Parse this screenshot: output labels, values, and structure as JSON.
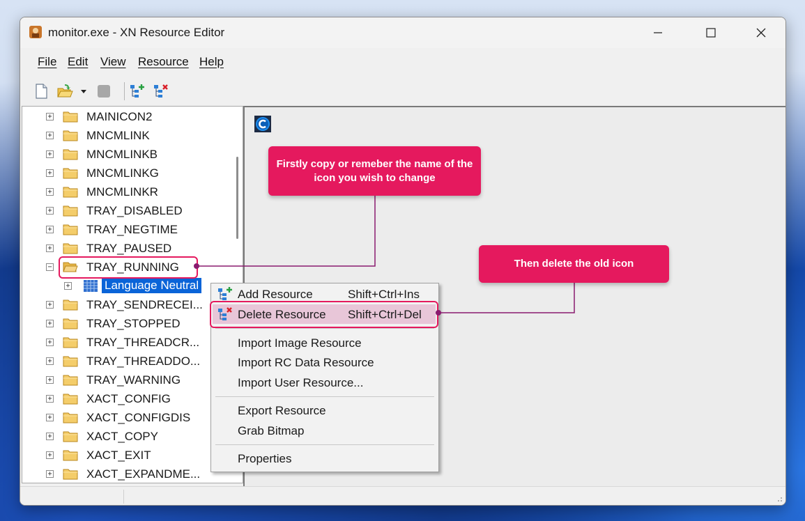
{
  "window": {
    "title": "monitor.exe - XN Resource Editor"
  },
  "menu": [
    "File",
    "Edit",
    "View",
    "Resource",
    "Help"
  ],
  "tree": {
    "items": [
      {
        "label": "MAINICON2",
        "expander": "+"
      },
      {
        "label": "MNCMLINK",
        "expander": "+"
      },
      {
        "label": "MNCMLINKB",
        "expander": "+"
      },
      {
        "label": "MNCMLINKG",
        "expander": "+"
      },
      {
        "label": "MNCMLINKR",
        "expander": "+"
      },
      {
        "label": "TRAY_DISABLED",
        "expander": "+"
      },
      {
        "label": "TRAY_NEGTIME",
        "expander": "+"
      },
      {
        "label": "TRAY_PAUSED",
        "expander": "+"
      },
      {
        "label": "TRAY_RUNNING",
        "expander": "−"
      },
      {
        "label": "Language Neutral",
        "expander": "+"
      },
      {
        "label": "TRAY_SENDRECEI...",
        "expander": "+"
      },
      {
        "label": "TRAY_STOPPED",
        "expander": "+"
      },
      {
        "label": "TRAY_THREADCR...",
        "expander": "+"
      },
      {
        "label": "TRAY_THREADDO...",
        "expander": "+"
      },
      {
        "label": "TRAY_WARNING",
        "expander": "+"
      },
      {
        "label": "XACT_CONFIG",
        "expander": "+"
      },
      {
        "label": "XACT_CONFIGDIS",
        "expander": "+"
      },
      {
        "label": "XACT_COPY",
        "expander": "+"
      },
      {
        "label": "XACT_EXIT",
        "expander": "+"
      },
      {
        "label": "XACT_EXPANDME...",
        "expander": "+"
      }
    ]
  },
  "context_menu": {
    "add": {
      "label": "Add Resource",
      "shortcut": "Shift+Ctrl+Ins"
    },
    "delete": {
      "label": "Delete Resource",
      "shortcut": "Shift+Ctrl+Del"
    },
    "import_image": "Import Image Resource",
    "import_rc": "Import RC Data Resource",
    "import_user": "Import User Resource...",
    "export": "Export Resource",
    "grab": "Grab Bitmap",
    "properties": "Properties"
  },
  "callouts": {
    "first": "Firstly copy or remeber the name of the icon you wish to change",
    "second": "Then delete the old icon"
  },
  "colors": {
    "accent": "#e5195e",
    "selection": "#0a64d8",
    "menu_highlight": "#e8c6d8"
  }
}
